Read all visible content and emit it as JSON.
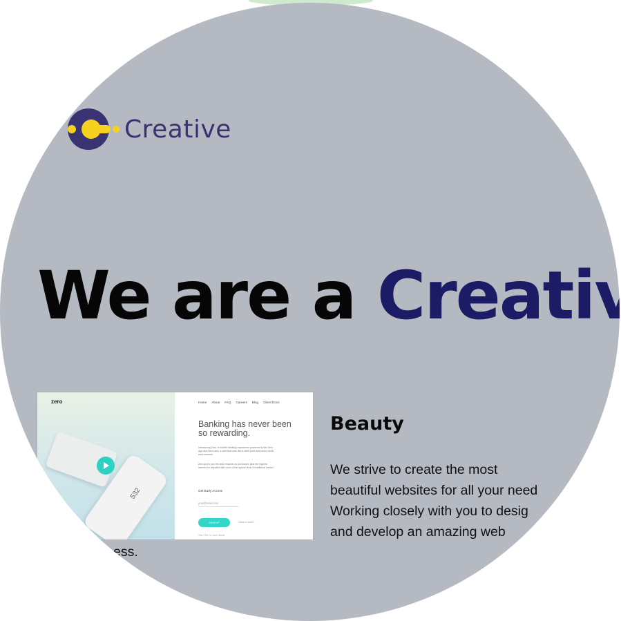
{
  "logo": {
    "text": "Creative",
    "mark_icon": "creative-logo-icon",
    "colors": {
      "yellow": "#f5d21f",
      "purple": "#3a3373"
    }
  },
  "hero": {
    "part1": "We are a ",
    "accent": "Creativ",
    "accent_color": "#1b1b66"
  },
  "preview": {
    "brand": "zero",
    "nav": [
      "Home",
      "About",
      "FAQ",
      "Careers",
      "Blog",
      "Client Docs"
    ],
    "headline": "Banking has never been so rewarding.",
    "paragraph1": "Introducing Zero. A mobile banking experience powered by the Zero app and Zero card, a card that acts like a debit card and earns credit card rewards.",
    "paragraph2": "Zero gives you the best rewards on purchases plus the highest interest on deposits with none of the typical fees of traditional banks.*",
    "early_access": "Get Early Access",
    "email_placeholder": "you@mail.com",
    "signup_label": "SIGN UP",
    "secondary_link": "Have a code?",
    "footer": "*See FDIC for more details",
    "phone_number": "532",
    "accent_color": "#33d6c9"
  },
  "feature": {
    "title": "Beauty",
    "body_lines": [
      "We strive to create the most",
      "beautiful websites for all your need",
      "Working closely with you to desig",
      "and develop an amazing web"
    ],
    "tail": "ess."
  },
  "colors": {
    "background": "#b5b9c2"
  }
}
